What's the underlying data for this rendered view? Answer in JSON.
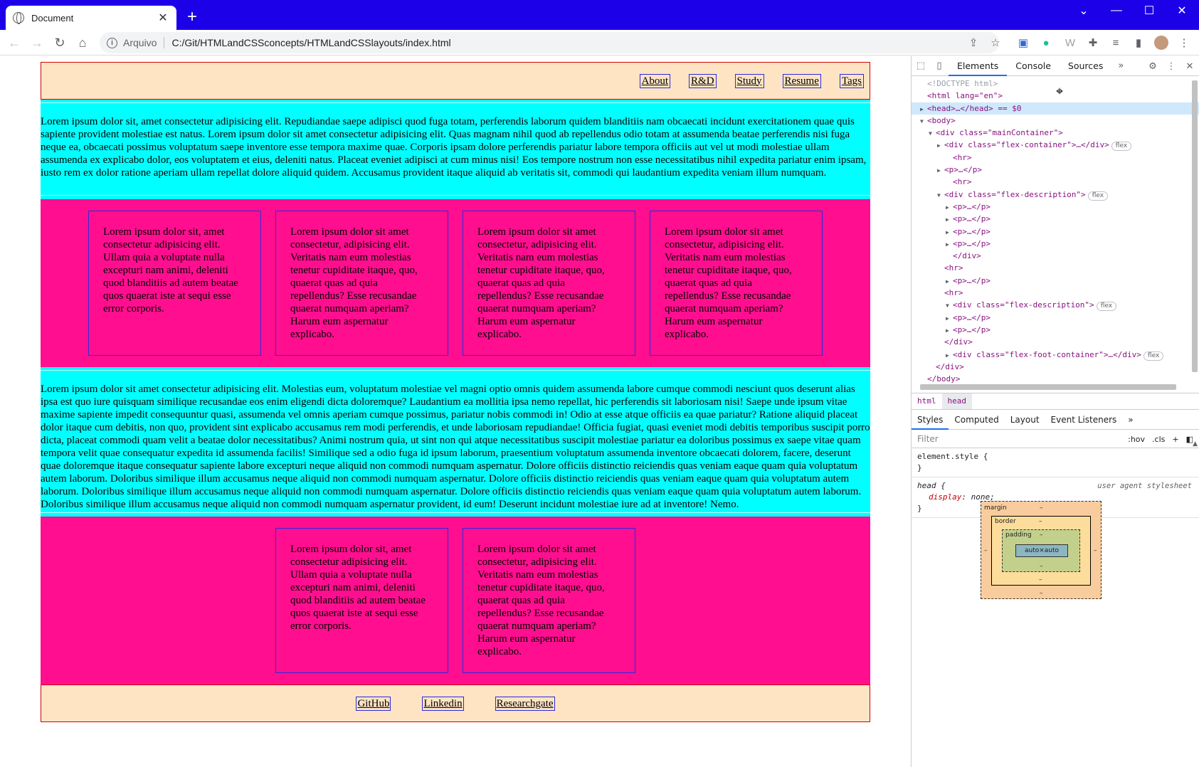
{
  "browser": {
    "tab_title": "Document",
    "new_tab": "+",
    "controls": {
      "minimize": "—",
      "maximize": "☐",
      "close": "✕",
      "menu": "⌄"
    },
    "address": {
      "scheme": "Arquivo",
      "url": "C:/Git/HTMLandCSSconcepts/HTMLandCSSlayouts/index.html"
    }
  },
  "page": {
    "nav": [
      "About",
      "R&D",
      "Study",
      "Resume",
      "Tags"
    ],
    "para1": "Lorem ipsum dolor sit, amet consectetur adipisicing elit. Repudiandae saepe adipisci quod fuga totam, perferendis laborum quidem blanditiis nam obcaecati incidunt exercitationem quae quis sapiente provident molestiae est natus. Lorem ipsum dolor sit amet consectetur adipisicing elit. Quas magnam nihil quod ab repellendus odio totam at assumenda beatae perferendis nisi fuga neque ea, obcaecati possimus voluptatum saepe inventore esse tempora maxime quae. Corporis ipsam dolore perferendis pariatur labore tempora officiis aut vel ut modi molestiae ullam assumenda ex explicabo dolor, eos voluptatem et eius, deleniti natus. Placeat eveniet adipisci at cum minus nisi! Eos tempore nostrum non esse necessitatibus nihil expedita pariatur enim ipsam, iusto rem ex dolor ratione aperiam ullam repellat dolore aliquid quidem. Accusamus provident itaque aliquid ab veritatis sit, commodi qui laudantium expedita veniam illum numquam.",
    "cards1": [
      "Lorem ipsum dolor sit, amet consectetur adipisicing elit. Ullam quia a voluptate nulla excepturi nam animi, deleniti quod blanditiis ad autem beatae quos quaerat iste at sequi esse error corporis.",
      "Lorem ipsum dolor sit amet consectetur, adipisicing elit. Veritatis nam eum molestias tenetur cupiditate itaque, quo, quaerat quas ad quia repellendus? Esse recusandae quaerat numquam aperiam? Harum eum aspernatur explicabo.",
      "Lorem ipsum dolor sit amet consectetur, adipisicing elit. Veritatis nam eum molestias tenetur cupiditate itaque, quo, quaerat quas ad quia repellendus? Esse recusandae quaerat numquam aperiam? Harum eum aspernatur explicabo.",
      "Lorem ipsum dolor sit amet consectetur, adipisicing elit. Veritatis nam eum molestias tenetur cupiditate itaque, quo, quaerat quas ad quia repellendus? Esse recusandae quaerat numquam aperiam? Harum eum aspernatur explicabo."
    ],
    "para2": "Lorem ipsum dolor sit amet consectetur adipisicing elit. Molestias eum, voluptatum molestiae vel magni optio omnis quidem assumenda labore cumque commodi nesciunt quos deserunt alias ipsa est quo iure quisquam similique recusandae eos enim eligendi dicta doloremque? Laudantium ea mollitia ipsa nemo repellat, hic perferendis sit laboriosam nisi! Saepe unde ipsum vitae maxime sapiente impedit consequuntur quasi, assumenda vel omnis aperiam cumque possimus, pariatur nobis commodi in! Odio at esse atque officiis ea quae pariatur? Ratione aliquid placeat dolor itaque cum debitis, non quo, provident sint explicabo accusamus rem modi perferendis, et unde laboriosam repudiandae! Officia fugiat, quasi eveniet modi debitis temporibus suscipit porro dicta, placeat commodi quam velit a beatae dolor necessitatibus? Animi nostrum quia, ut sint non qui atque necessitatibus suscipit molestiae pariatur ea doloribus possimus ex saepe vitae quam tempora velit quae consequatur expedita id assumenda facilis! Similique sed a odio fuga id ipsum laborum, praesentium voluptatum assumenda inventore obcaecati dolorem, facere, deserunt quae doloremque itaque consequatur sapiente labore excepturi neque aliquid non commodi numquam aspernatur. Dolore officiis distinctio reiciendis quas veniam eaque quam quia voluptatum autem laborum. Doloribus similique illum accusamus neque aliquid non commodi numquam aspernatur. Dolore officiis distinctio reiciendis quas veniam eaque quam quia voluptatum autem laborum. Doloribus similique illum accusamus neque aliquid non commodi numquam aspernatur.",
    "para2_visible": "Lorem ipsum dolor sit amet consectetur adipisicing elit. Molestias eum, voluptatum molestiae vel magni optio omnis quidem assumenda labore cumque commodi nesciunt quos deserunt alias ipsa est quo iure quisquam similique recusandae eos enim eligendi dicta doloremque? Laudantium ea mollitia ipsa nemo repellat, hic perferendis sit laboriosam nisi! Saepe unde ipsum vitae maxime sapiente impedit consequuntur quasi, assumenda vel omnis aperiam cumque possimus, pariatur nobis commodi in! Odio at esse atque officiis ea quae pariatur? Ratione aliquid placeat dolor itaque cum debitis, non quo, provident sint explicabo accusamus rem modi perferendis, et unde laboriosam repudiandae! Officia fugiat, quasi eveniet modi debitis temporibus suscipit porro dicta, placeat commodi quam velit a beatae dolor necessitatibus? Animi nostrum quia, ut sint non qui atque necessitatibus suscipit molestiae pariatur ea doloribus possimus ex saepe vitae quam tempora velit quae consequatur expedita id assumenda facilis! Similique sed a odio fuga id ipsum laborum, praesentium voluptatum assumenda inventore obcaecati dolorem, facere, deserunt quae doloremque itaque consequatur sapiente labore excepturi neque aliquid non commodi numquam aspernatur. Dolore officiis distinctio reiciendis quas veniam eaque quam quia voluptatum autem laborum. Doloribus similique illum accusamus neque aliquid non commodi numquam aspernatur. Dolore officiis distinctio reiciendis quas veniam eaque quam quia voluptatum autem laborum. Doloribus similique illum accusamus neque aliquid non commodi numquam aspernatur. Dolore officiis distinctio reiciendis quas veniam eaque quam quia voluptatum autem laborum. Doloribus similique illum accusamus neque aliquid non commodi numquam aspernatur provident, id eum! Deserunt incidunt molestiae iure ad at inventore! Nemo.",
    "cards2": [
      "Lorem ipsum dolor sit, amet consectetur adipisicing elit. Ullam quia a voluptate nulla excepturi nam animi, deleniti quod blanditiis ad autem beatae quos quaerat iste at sequi esse error corporis.",
      "Lorem ipsum dolor sit amet consectetur, adipisicing elit. Veritatis nam eum molestias tenetur cupiditate itaque, quo, quaerat quas ad quia repellendus? Esse recusandae quaerat numquam aperiam? Harum eum aspernatur explicabo."
    ],
    "footer": [
      "GitHub",
      "Linkedin",
      "Researchgate"
    ],
    "colors": {
      "nav_bg": "#ffe4c4",
      "para_bg": "#00ffff",
      "desc_bg": "#ff0f8f",
      "border": "#d40000",
      "link_border": "#2a2ae0"
    }
  },
  "devtools": {
    "tabs": [
      "Elements",
      "Console",
      "Sources"
    ],
    "more": "»",
    "dom": [
      "<!DOCTYPE html>",
      "<html lang=\"en\">",
      "<head>…</head> == $0",
      "<body>",
      "<div class=\"mainContainer\">",
      "<div class=\"flex-container\">…</div>",
      "<hr>",
      "<p>…</p>",
      "<hr>",
      "<div class=\"flex-description\">",
      "<p>…</p>",
      "<p>…</p>",
      "<p>…</p>",
      "<p>…</p>",
      "</div>",
      "<hr>",
      "<p>…</p>",
      "<hr>",
      "<div class=\"flex-description\">",
      "<p>…</p>",
      "<p>…</p>",
      "</div>",
      "<div class=\"flex-foot-container\">…</div>",
      "</div>",
      "</body>"
    ],
    "badge": "flex",
    "breadcrumbs": [
      "html",
      "head"
    ],
    "style_tabs": [
      "Styles",
      "Computed",
      "Layout",
      "Event Listeners"
    ],
    "filter_placeholder": "Filter",
    "filter_tools": [
      ":hov",
      ".cls",
      "+"
    ],
    "rule1_selector": "element.style {",
    "rule_close": "}",
    "rule2_selector": "head {",
    "rule2_source": "user agent stylesheet",
    "rule2_prop": "display",
    "rule2_value": "none;",
    "boxmodel": {
      "margin": "margin",
      "border": "border",
      "padding": "padding",
      "content": "auto×auto",
      "dash": "–"
    }
  }
}
